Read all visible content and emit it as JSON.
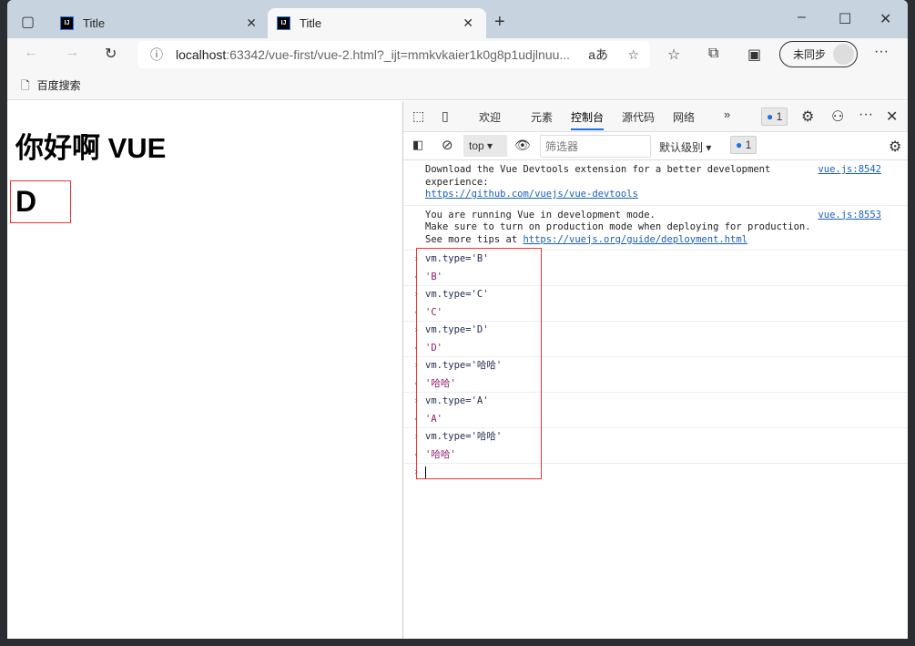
{
  "browser": {
    "tabs": [
      {
        "title": "Title",
        "favicon": "IJ"
      },
      {
        "title": "Title",
        "favicon": "IJ"
      }
    ],
    "address": {
      "host": "localhost",
      "rest": ":63342/vue-first/vue-2.html?_ijt=mmkvkaier1k0g8p1udjlnuu..."
    },
    "read_aloud": "aあ",
    "sync_label": "未同步",
    "bookmarks": [
      {
        "label": "百度搜索"
      }
    ]
  },
  "page": {
    "heading": "你好啊 VUE",
    "value": "D"
  },
  "devtools": {
    "tabs": [
      "欢迎",
      "元素",
      "控制台",
      "源代码",
      "网络"
    ],
    "active_tab": "控制台",
    "issues_count": "1",
    "context": "top",
    "filter_placeholder": "筛选器",
    "level": "默认级别",
    "messages_count": "1",
    "messages": [
      {
        "lines": [
          "Download the Vue Devtools extension for a better development",
          "experience:"
        ],
        "link": "https://github.com/vuejs/vue-devtools",
        "source": "vue.js:8542"
      },
      {
        "lines": [
          "You are running Vue in development mode.",
          "Make sure to turn on production mode when deploying for production.",
          "See more tips at "
        ],
        "link": "https://vuejs.org/guide/deployment.html",
        "source": "vue.js:8553"
      }
    ],
    "console": [
      {
        "input": "vm.type='B'",
        "output": "'B'"
      },
      {
        "input": "vm.type='C'",
        "output": "'C'"
      },
      {
        "input": "vm.type='D'",
        "output": "'D'"
      },
      {
        "input": "vm.type='哈哈'",
        "output": "'哈哈'"
      },
      {
        "input": "vm.type='A'",
        "output": "'A'"
      },
      {
        "input": "vm.type='哈哈'",
        "output": "'哈哈'"
      }
    ]
  }
}
